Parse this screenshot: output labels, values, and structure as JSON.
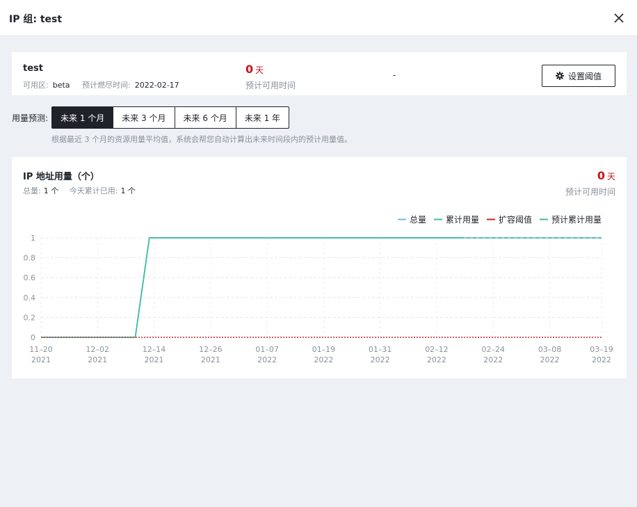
{
  "header": {
    "title": "IP 组: test"
  },
  "summary": {
    "name": "test",
    "zone_label": "可用区:",
    "zone_value": "beta",
    "exhaust_label": "预计燃尽时间:",
    "exhaust_value": "2022-02-17",
    "days_value": "0",
    "days_unit": "天",
    "days_label": "预计可用时间",
    "dash": "-",
    "threshold_button": "设置阈值"
  },
  "forecast": {
    "label": "用量预测:",
    "options": [
      "未来 1 个月",
      "未来 3 个月",
      "未来 6 个月",
      "未来 1 年"
    ],
    "selected_index": 0,
    "hint": "根据最近 3 个月的资源用量平均值，系统会帮您自动计算出未来时间段内的预计用量值。"
  },
  "chart_card": {
    "title": "IP 地址用量（个）",
    "total_label": "总量:",
    "total_value": "1 个",
    "today_label": "今天累计已用:",
    "today_value": "1 个",
    "days_value": "0",
    "days_unit": "天",
    "days_label": "预计可用时间"
  },
  "colors": {
    "total": "#7ab6d9",
    "cumulative": "#3dbba1",
    "threshold": "#d0222b",
    "predicted": "#3dbba1",
    "accent_red": "#c7161e",
    "dark": "#1f2329"
  },
  "chart_data": {
    "type": "line",
    "title": "",
    "xlabel": "",
    "ylabel": "",
    "ylim": [
      0,
      1
    ],
    "yticks": [
      "0",
      "0.2",
      "0.4",
      "0.6",
      "0.8",
      "1"
    ],
    "ytick_values": [
      0,
      0.2,
      0.4,
      0.6,
      0.8,
      1
    ],
    "xlim": [
      "2021-11-20",
      "2022-03-19"
    ],
    "xticks": [
      {
        "date": "2021-11-20",
        "line1": "11–20",
        "line2": "2021"
      },
      {
        "date": "2021-12-02",
        "line1": "12–02",
        "line2": "2021"
      },
      {
        "date": "2021-12-14",
        "line1": "12–14",
        "line2": "2021"
      },
      {
        "date": "2021-12-26",
        "line1": "12–26",
        "line2": "2021"
      },
      {
        "date": "2022-01-07",
        "line1": "01–07",
        "line2": "2022"
      },
      {
        "date": "2022-01-19",
        "line1": "01–19",
        "line2": "2022"
      },
      {
        "date": "2022-01-31",
        "line1": "01–31",
        "line2": "2022"
      },
      {
        "date": "2022-02-12",
        "line1": "02–12",
        "line2": "2022"
      },
      {
        "date": "2022-02-24",
        "line1": "02–24",
        "line2": "2022"
      },
      {
        "date": "2022-03-08",
        "line1": "03–08",
        "line2": "2022"
      },
      {
        "date": "2022-03-19",
        "line1": "03–19",
        "line2": "2022"
      }
    ],
    "grid": true,
    "legend": "top-right",
    "series": [
      {
        "name": "总量",
        "style": "solid",
        "points": [
          [
            "2021-11-20",
            0
          ],
          [
            "2021-12-10",
            0
          ],
          [
            "2021-12-13",
            1
          ],
          [
            "2022-03-19",
            1
          ]
        ]
      },
      {
        "name": "累计用量",
        "style": "solid",
        "points": [
          [
            "2021-11-20",
            0
          ],
          [
            "2021-12-10",
            0
          ],
          [
            "2021-12-13",
            1
          ],
          [
            "2022-02-17",
            1
          ]
        ]
      },
      {
        "name": "扩容阈值",
        "style": "dotted",
        "points": [
          [
            "2021-11-20",
            0
          ],
          [
            "2022-03-19",
            0
          ]
        ]
      },
      {
        "name": "预计累计用量",
        "style": "dashed",
        "points": [
          [
            "2022-02-17",
            1
          ],
          [
            "2022-03-19",
            1
          ]
        ]
      }
    ]
  }
}
